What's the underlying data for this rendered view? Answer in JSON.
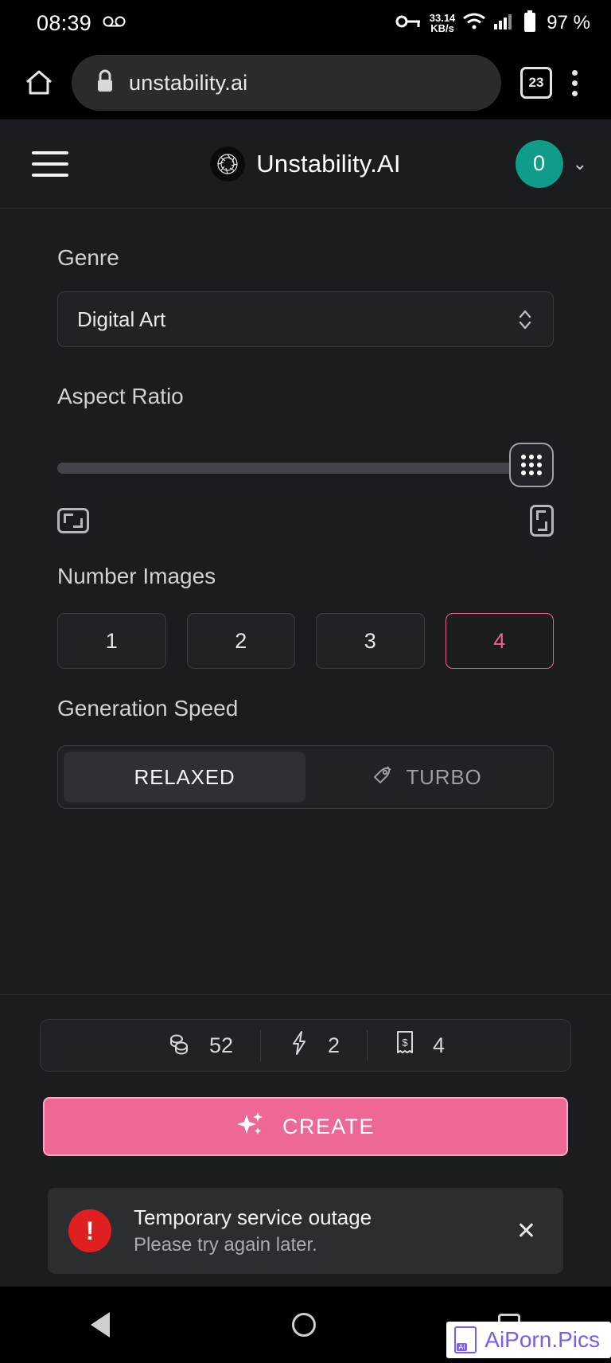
{
  "statusbar": {
    "time": "08:39",
    "voicemail_icon": "voicemail-icon",
    "vpn_icon": "vpn-key-icon",
    "net_speed_value": "33.14",
    "net_speed_unit": "KB/s",
    "wifi_icon": "wifi-icon",
    "signal_icon": "cellular-signal-icon",
    "battery_icon": "battery-icon",
    "battery_text": "97 %"
  },
  "browser": {
    "home_icon": "home-icon",
    "lock_icon": "lock-icon",
    "url": "unstability.ai",
    "tab_count": "23",
    "menu_icon": "overflow-menu-icon"
  },
  "appheader": {
    "menu_icon": "hamburger-menu-icon",
    "logo_icon": "unstability-logo-icon",
    "title": "Unstability.AI",
    "credits": "0",
    "chevron_icon": "chevron-down-icon"
  },
  "form": {
    "genre": {
      "label": "Genre",
      "value": "Digital Art",
      "caret_icon": "select-caret-icon"
    },
    "aspect_ratio": {
      "label": "Aspect Ratio",
      "slider_position_percent": 100,
      "thumb_icon": "grid-dots-handle-icon",
      "landscape_icon": "landscape-ratio-icon",
      "portrait_icon": "portrait-ratio-icon"
    },
    "number_images": {
      "label": "Number Images",
      "options": [
        "1",
        "2",
        "3",
        "4"
      ],
      "selected": "4",
      "accent_color": "#ef5f8e"
    },
    "generation_speed": {
      "label": "Generation Speed",
      "options": [
        "RELAXED",
        "TURBO"
      ],
      "selected": "RELAXED",
      "turbo_icon": "rocket-icon"
    }
  },
  "footer": {
    "stats": [
      {
        "icon": "coins-icon",
        "value": "52"
      },
      {
        "icon": "lightning-bolt-icon",
        "value": "2"
      },
      {
        "icon": "receipt-icon",
        "value": "4"
      }
    ],
    "create_button": {
      "label": "CREATE",
      "icon": "sparkles-icon",
      "color": "#ee6896"
    },
    "toast": {
      "icon": "error-alert-icon",
      "title": "Temporary service outage",
      "subtitle": "Please try again later.",
      "close_icon": "close-icon",
      "icon_color": "#e02020"
    }
  },
  "navbar": {
    "back_icon": "nav-back-icon",
    "home_icon": "nav-home-icon",
    "recents_icon": "nav-recents-icon",
    "watermark_text": "AiPorn.Pics",
    "watermark_icon": "ai-file-icon"
  }
}
